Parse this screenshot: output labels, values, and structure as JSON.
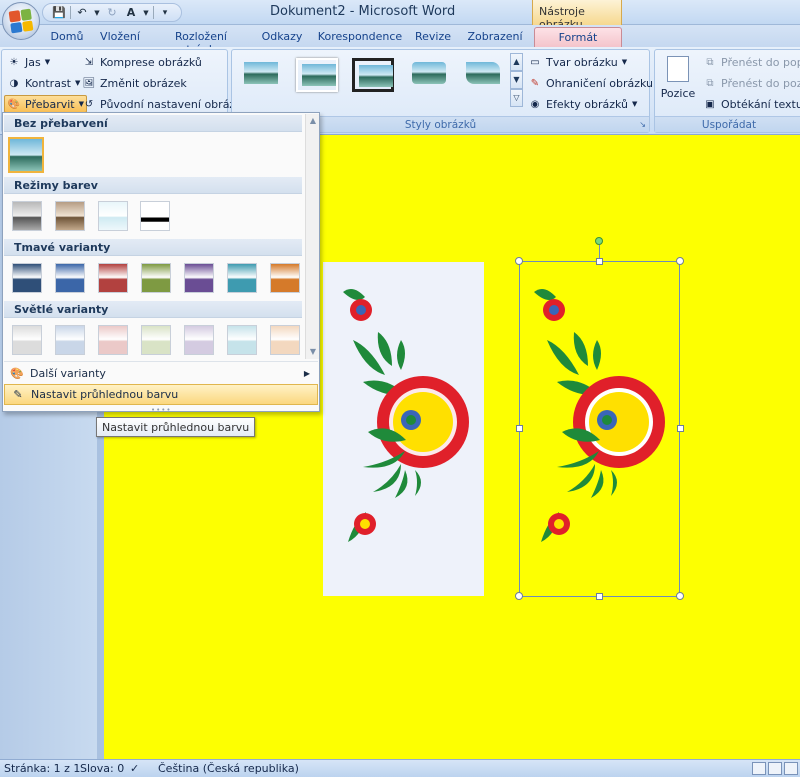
{
  "window": {
    "title": "Dokument2 - Microsoft Word",
    "context_title": "Nástroje obrázku"
  },
  "quick_access": {
    "icons": [
      "save-icon",
      "undo-icon",
      "redo-icon",
      "format-painter-icon",
      "customize-icon"
    ]
  },
  "tabs": [
    {
      "label": "Domů"
    },
    {
      "label": "Vložení"
    },
    {
      "label": "Rozložení stránky"
    },
    {
      "label": "Odkazy"
    },
    {
      "label": "Korespondence"
    },
    {
      "label": "Revize"
    },
    {
      "label": "Zobrazení"
    },
    {
      "label": "Formát",
      "active": true
    }
  ],
  "ribbon": {
    "adjust": {
      "brightness": "Jas",
      "contrast": "Kontrast",
      "recolor": "Přebarvit",
      "compress": "Komprese obrázků",
      "change": "Změnit obrázek",
      "reset": "Původní nastavení obrázku"
    },
    "styles": {
      "label": "Styly obrázků",
      "shape": "Tvar obrázku",
      "border": "Ohraničení obrázku",
      "effects": "Efekty obrázků"
    },
    "arrange": {
      "label": "Uspořádat",
      "position": "Pozice",
      "bring_front": "Přenést do popře",
      "send_back": "Přenést do pozad",
      "wrap": "Obtékání textu"
    }
  },
  "recolor_menu": {
    "no_recolor": "Bez přebarvení",
    "color_modes": "Režimy barev",
    "dark_variants": "Tmavé varianty",
    "light_variants": "Světlé varianty",
    "more_variants": "Další varianty",
    "set_transparent": "Nastavit průhlednou barvu",
    "dark_colors": [
      "#2f4f78",
      "#3b66a8",
      "#b2413f",
      "#7e9a42",
      "#6a4d94",
      "#3e9bb0",
      "#d57a2a"
    ],
    "light_colors": [
      "#dcdcdc",
      "#c9d6e8",
      "#ebc9c8",
      "#d9e3c6",
      "#d4cbe1",
      "#c6e3ea",
      "#f3d8bf"
    ]
  },
  "tooltip": {
    "text": "Nastavit průhlednou barvu"
  },
  "status": {
    "page": "Stránka: 1 z 1",
    "words": "Slova: 0",
    "language": "Čeština (Česká republika)"
  },
  "colors": {
    "page_background": "#fdff01",
    "flower_red": "#e0202a",
    "leaf_green": "#1f8a3a",
    "center_yellow": "#ffe000",
    "center_blue": "#3a66b8"
  }
}
